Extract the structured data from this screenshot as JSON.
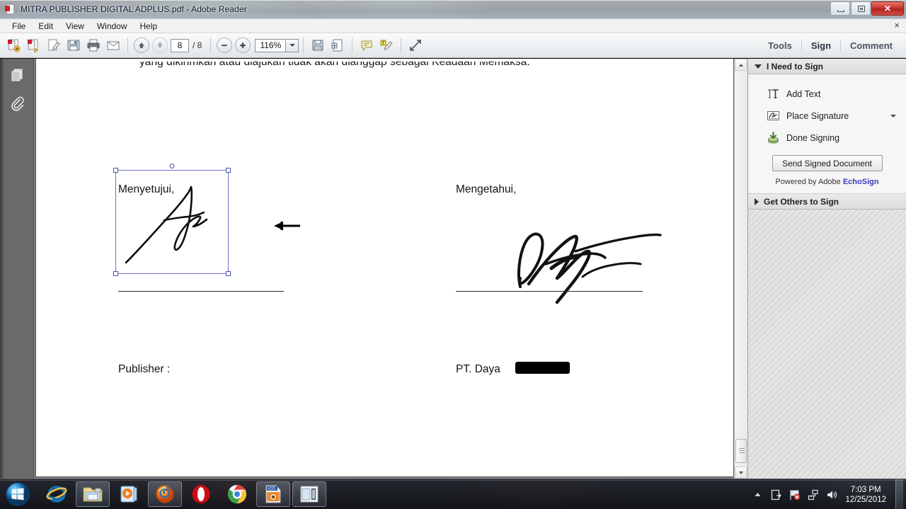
{
  "window": {
    "title": "MITRA PUBLISHER DIGITAL ADPLUS.pdf - Adobe Reader",
    "icon": "pdf-document-icon",
    "minimize_label": "Minimize",
    "restore_label": "Restore",
    "close_label": "Close"
  },
  "menu": {
    "items": [
      {
        "label": "File"
      },
      {
        "label": "Edit"
      },
      {
        "label": "View"
      },
      {
        "label": "Window"
      },
      {
        "label": "Help"
      }
    ],
    "close_x": "×"
  },
  "toolbar": {
    "buttons": [
      {
        "name": "create-pdf-icon",
        "title": "Create PDF"
      },
      {
        "name": "export-pdf-icon",
        "title": "Export PDF"
      },
      {
        "name": "edit-pdf-icon",
        "title": "Edit PDF"
      },
      {
        "name": "save-icon",
        "title": "Save"
      },
      {
        "name": "print-icon",
        "title": "Print"
      },
      {
        "name": "email-icon",
        "title": "Email"
      }
    ],
    "page_up": "▲",
    "page_down": "▼",
    "page_current": "8",
    "page_total": "/ 8",
    "zoom_out": "−",
    "zoom_in": "+",
    "zoom_value": "116%",
    "right_buttons": [
      {
        "name": "save-file-icon",
        "title": "Save"
      },
      {
        "name": "page-tools-icon",
        "title": "Page Tools"
      },
      {
        "name": "sticky-note-icon",
        "title": "Sticky Note"
      },
      {
        "name": "highlight-text-icon",
        "title": "Highlight Text"
      },
      {
        "name": "fullscreen-icon",
        "title": "Read Mode"
      }
    ],
    "tools_label": "Tools",
    "sign_label": "Sign",
    "comment_label": "Comment"
  },
  "nav_pane": {
    "items": [
      {
        "name": "page-thumbnails-icon",
        "title": "Page Thumbnails"
      },
      {
        "name": "attachments-icon",
        "title": "Attachments"
      }
    ]
  },
  "document": {
    "top_line": "yang dikirimkan atau diajukan tidak akan dianggap sebagai Keadaan Memaksa.",
    "left_heading": "Menyetujui,",
    "right_heading": "Mengetahui,",
    "left_caption": "Publisher :",
    "right_caption": "PT. Daya",
    "right_caption_redacted": "redacted-company-name",
    "left_signature": "handwritten-signature-selected",
    "right_signature": "handwritten-signature"
  },
  "sign_panel": {
    "section_title": "I Need to Sign",
    "rows": [
      {
        "label": "Add Text",
        "icon": "add-text-icon"
      },
      {
        "label": "Place Signature",
        "icon": "place-signature-icon",
        "has_dropdown": true
      },
      {
        "label": "Done Signing",
        "icon": "done-signing-icon"
      }
    ],
    "send_button": "Send Signed Document",
    "powered_prefix": "Powered by Adobe",
    "powered_brand": "EchoSign",
    "second_section_title": "Get Others to Sign"
  },
  "taskbar": {
    "start": "start-orb-icon",
    "items": [
      {
        "name": "internet-explorer-icon",
        "running": false
      },
      {
        "name": "windows-explorer-icon",
        "running": true
      },
      {
        "name": "windows-media-player-icon",
        "running": false
      },
      {
        "name": "firefox-icon",
        "running": true
      },
      {
        "name": "opera-icon",
        "running": false
      },
      {
        "name": "google-chrome-icon",
        "running": false
      },
      {
        "name": "image-converter-icon",
        "running": true
      },
      {
        "name": "adobe-reader-icon",
        "running": true
      }
    ],
    "tray": [
      {
        "name": "show-hidden-icons-arrow"
      },
      {
        "name": "device-action-icon"
      },
      {
        "name": "flag-alert-icon"
      },
      {
        "name": "network-icon"
      },
      {
        "name": "volume-icon"
      }
    ],
    "time": "7:03 PM",
    "date": "12/25/2012"
  },
  "colors": {
    "accent_selection": "#6a72c8",
    "close_button": "#c3342b",
    "echosign_brand": "#3a3ac0",
    "document_bg": "#808080"
  }
}
